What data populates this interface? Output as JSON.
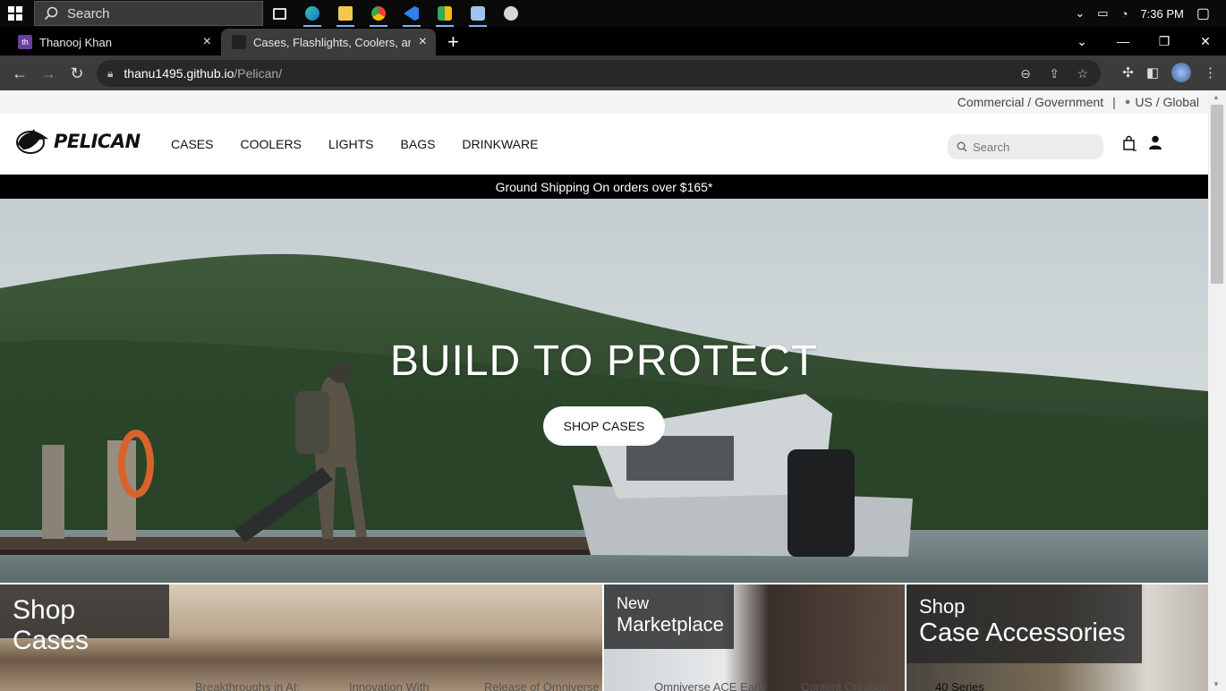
{
  "taskbar": {
    "search_placeholder": "Search",
    "clock": "7:36 PM",
    "apps": [
      "task-view-icon",
      "edge-icon",
      "file-explorer-icon",
      "chrome-icon",
      "vscode-icon",
      "meet-icon",
      "notepad-icon",
      "app-icon"
    ]
  },
  "browser": {
    "tabs": [
      {
        "favicon": "th",
        "title": "Thanooj Khan"
      },
      {
        "favicon": "",
        "title": "Cases, Flashlights, Coolers, and Tr"
      }
    ],
    "url_host": "thanu1495.github.io",
    "url_path": "/Pelican/"
  },
  "site": {
    "utility": {
      "commercial": "Commercial / Government",
      "separator": "|",
      "region": "US / Global"
    },
    "brand": "PELICAN",
    "nav": [
      "CASES",
      "COOLERS",
      "LIGHTS",
      "BAGS",
      "DRINKWARE"
    ],
    "search_placeholder": "Search",
    "promo": "Ground Shipping On orders over $165*",
    "hero": {
      "title": "BUILD TO PROTECT",
      "cta": "SHOP CASES"
    },
    "tiles": [
      {
        "line1": "Shop Cases"
      },
      {
        "line1": "New",
        "line2": "Marketplace"
      },
      {
        "line1": "Shop",
        "line2": "Case Accessories"
      }
    ],
    "below_fold": [
      "Breakthroughs in AI:",
      "Innovation With",
      "Release of Omniverse",
      "Omniverse ACE Early",
      "Content Creation",
      "40 Series"
    ]
  },
  "colors": {
    "promo_bg": "#000000",
    "accent": "#111111"
  }
}
